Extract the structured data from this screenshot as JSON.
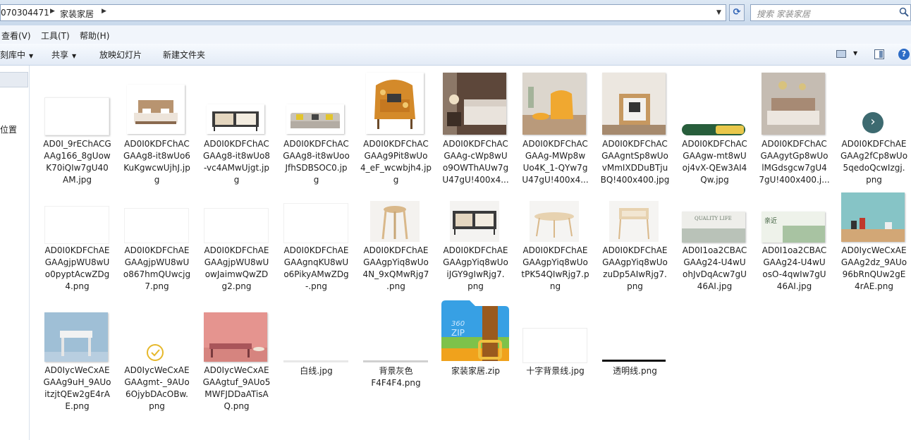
{
  "address": {
    "crumbs": [
      "070304471",
      "家装家居"
    ],
    "search_placeholder": "搜索 家装家居"
  },
  "menu": {
    "items": [
      "查看(V)",
      "工具(T)",
      "帮助(H)"
    ]
  },
  "toolbar": {
    "items": [
      "刻库中",
      "共享",
      "放映幻灯片",
      "新建文件夹"
    ]
  },
  "nav": {
    "label": "位置"
  },
  "files": [
    {
      "name": "AD0I_9rEChACGAAg166_8gUowK70iQIw7gU40AM.jpg",
      "lines": [
        "AD0I_9rEChACG",
        "AAg166_8gUow",
        "K70iQIw7gU40",
        "AM.jpg"
      ]
    },
    {
      "name": "AD0I0KDFChACGAAg8-it8wUo6KuKgwcwUjhJ.jpg",
      "lines": [
        "AD0I0KDFChAC",
        "GAAg8-it8wUo6",
        "KuKgwcwUjhJ.jp",
        "g"
      ]
    },
    {
      "name": "AD0I0KDFChACGAAg8-it8wUo8-vc4AMwUjgt.jpg",
      "lines": [
        "AD0I0KDFChAC",
        "GAAg8-it8wUo8",
        "-vc4AMwUjgt.jp",
        "g"
      ]
    },
    {
      "name": "AD0I0KDFChACGAAg8-it8wUooJfhSDBSOC0.jpg",
      "lines": [
        "AD0I0KDFChAC",
        "GAAg8-it8wUoo",
        "JfhSDBSOC0.jp",
        "g"
      ]
    },
    {
      "name": "AD0I0KDFChACGAAg9Pit8wUo4_eF_wcwbjh4.jpg",
      "lines": [
        "AD0I0KDFChAC",
        "GAAg9Pit8wUo",
        "4_eF_wcwbjh4.jp",
        "g"
      ]
    },
    {
      "name": "AD0I0KDFChACGAAg-cWp8wUo9OWThAUw7gU47gU!400x4...",
      "lines": [
        "AD0I0KDFChAC",
        "GAAg-cWp8wU",
        "o9OWThAUw7g",
        "U47gU!400x4..."
      ]
    },
    {
      "name": "AD0I0KDFChACGAAg-MWp8wUo4K_1-QYw7gU47gU!400x4...",
      "lines": [
        "AD0I0KDFChAC",
        "GAAg-MWp8w",
        "Uo4K_1-QYw7g",
        "U47gU!400x4..."
      ]
    },
    {
      "name": "AD0I0KDFChACGAAgntSp8wUovMmIXDDuBTjuBQ!400x400.jpg",
      "lines": [
        "AD0I0KDFChAC",
        "GAAgntSp8wUo",
        "vMmIXDDuBTju",
        "BQ!400x400.jpg"
      ]
    },
    {
      "name": "AD0I0KDFChACGAAgw-mt8wUoj4vX-QEw3AI4Qw.jpg",
      "lines": [
        "AD0I0KDFChAC",
        "GAAgw-mt8wU",
        "oj4vX-QEw3AI4",
        "Qw.jpg"
      ]
    },
    {
      "name": "AD0I0KDFChACGAAgytGp8wUolMGdsgcw7gU47gU!400x400.j...",
      "lines": [
        "AD0I0KDFChAC",
        "GAAgytGp8wUo",
        "lMGdsgcw7gU4",
        "7gU!400x400.j..."
      ]
    },
    {
      "name": "AD0I0KDFChAEGAAg2fCp8wUo5qedoQcwIzgj.png",
      "lines": [
        "AD0I0KDFChAE",
        "GAAg2fCp8wUo",
        "5qedoQcwIzgj.",
        "png"
      ]
    },
    {
      "name": "AD0I0KDFChAEGAAgjpWU8wUo0pyptAcwZDg4.png",
      "lines": [
        "AD0I0KDFChAE",
        "GAAgjpWU8wU",
        "o0pyptAcwZDg",
        "4.png"
      ]
    },
    {
      "name": "AD0I0KDFChAEGAAgjpWU8wUo867hmQUwcjg7.png",
      "lines": [
        "AD0I0KDFChAE",
        "GAAgjpWU8wU",
        "o867hmQUwcjg",
        "7.png"
      ]
    },
    {
      "name": "AD0I0KDFChAEGAAgjpWU8wUowJaimwQwZDg2.png",
      "lines": [
        "AD0I0KDFChAE",
        "GAAgjpWU8wU",
        "owJaimwQwZD",
        "g2.png"
      ]
    },
    {
      "name": "AD0I0KDFChAEGAAgnqKU8wUo6PikyAMwZDg-.png",
      "lines": [
        "AD0I0KDFChAE",
        "GAAgnqKU8wU",
        "o6PikyAMwZDg",
        "-.png"
      ]
    },
    {
      "name": "AD0I0KDFChAEGAAgpYiq8wUo4N_9xQMwRjg7.png",
      "lines": [
        "AD0I0KDFChAE",
        "GAAgpYiq8wUo",
        "4N_9xQMwRjg7",
        ".png"
      ]
    },
    {
      "name": "AD0I0KDFChAEGAAgpYiq8wUoiJGY9gIwRjg7.png",
      "lines": [
        "AD0I0KDFChAE",
        "GAAgpYiq8wUo",
        "iJGY9gIwRjg7.",
        "png"
      ]
    },
    {
      "name": "AD0I0KDFChAEGAAgpYiq8wUotPK54QIwRjg7.png",
      "lines": [
        "AD0I0KDFChAE",
        "GAAgpYiq8wUo",
        "tPK54QIwRjg7.p",
        "ng"
      ]
    },
    {
      "name": "AD0I0KDFChAEGAAgpYiq8wUozuDp5AIwRjg7.png",
      "lines": [
        "AD0I0KDFChAE",
        "GAAgpYiq8wUo",
        "zuDp5AIwRjg7.",
        "png"
      ]
    },
    {
      "name": "AD0I1oa2CBACGAAg24-U4wUohJvDqAcw7gU46AI.jpg",
      "lines": [
        "AD0I1oa2CBAC",
        "GAAg24-U4wU",
        "ohJvDqAcw7gU",
        "46AI.jpg"
      ]
    },
    {
      "name": "AD0I1oa2CBACGAAg24-U4wUosO-4qwIw7gU46AI.jpg",
      "lines": [
        "AD0I1oa2CBAC",
        "GAAg24-U4wU",
        "osO-4qwIw7gU",
        "46AI.jpg"
      ]
    },
    {
      "name": "AD0IycWeCxAEGAAg2dz_9AUo96bRnQUw2gE4rAE.png",
      "lines": [
        "AD0IycWeCxAE",
        "GAAg2dz_9AUo",
        "96bRnQUw2gE",
        "4rAE.png"
      ]
    },
    {
      "name": "AD0IycWeCxAEGAAg9uH_9AUoitzjtQEw2gE4rAE.png",
      "lines": [
        "AD0IycWeCxAE",
        "GAAg9uH_9AUo",
        "itzjtQEw2gE4rA",
        "E.png"
      ]
    },
    {
      "name": "AD0IycWeCxAEGAAgmt-_9AUo6OjybDAcOBw.png",
      "lines": [
        "AD0IycWeCxAE",
        "GAAgmt-_9AUo",
        "6OjybDAcOBw.",
        "png"
      ]
    },
    {
      "name": "AD0IycWeCxAEGAAgtuf_9AUo5MWFJDDaATisAQ.png",
      "lines": [
        "AD0IycWeCxAE",
        "GAAgtuf_9AUo5",
        "MWFJDDaATisA",
        "Q.png"
      ]
    },
    {
      "name": "白线.jpg",
      "lines": [
        "白线.jpg"
      ]
    },
    {
      "name": "背景灰色F4F4F4.png",
      "lines": [
        "背景灰色",
        "F4F4F4.png"
      ]
    },
    {
      "name": "家装家居.zip",
      "lines": [
        "家装家居.zip"
      ]
    },
    {
      "name": "十字背景线.jpg",
      "lines": [
        "十字背景线.jpg"
      ]
    },
    {
      "name": "透明线.png",
      "lines": [
        "透明线.png"
      ]
    }
  ],
  "zip_icon": {
    "brand": "360",
    "type": "ZIP"
  },
  "banner_text": [
    "QUALITY LIFE",
    "亲近"
  ]
}
